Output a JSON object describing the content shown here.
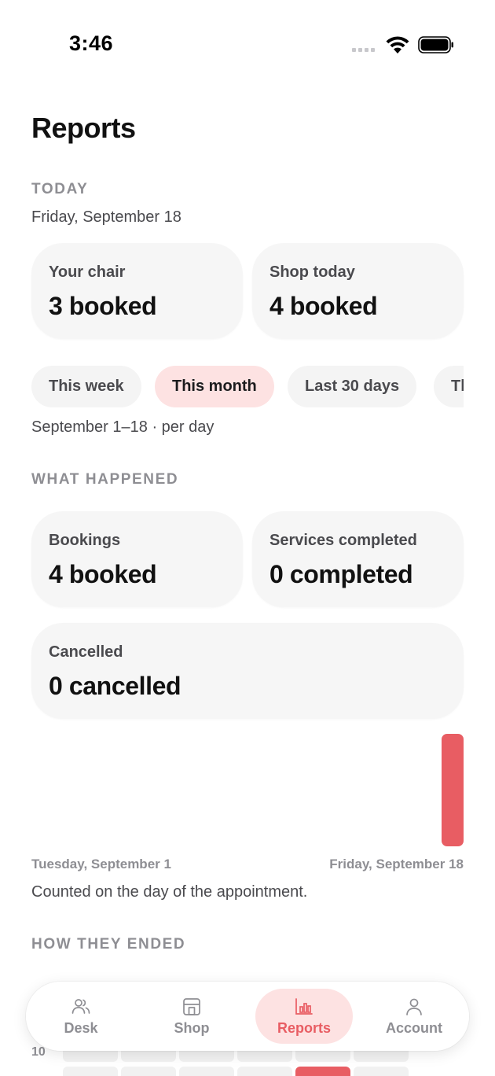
{
  "status": {
    "time": "3:46"
  },
  "title": "Reports",
  "today": {
    "label": "TODAY",
    "date": "Friday, September 18",
    "cards": [
      {
        "label": "Your chair",
        "value": "3 booked"
      },
      {
        "label": "Shop today",
        "value": "4 booked"
      }
    ]
  },
  "filters": {
    "chips": [
      "This week",
      "This month",
      "Last 30 days",
      "Th"
    ],
    "active": "This month",
    "range_text": "September 1–18 · per day"
  },
  "what_happened": {
    "label": "WHAT HAPPENED",
    "cards": [
      {
        "label": "Bookings",
        "value": "4 booked"
      },
      {
        "label": "Services completed",
        "value": "0 completed"
      },
      {
        "label": "Cancelled",
        "value": "0 cancelled"
      }
    ]
  },
  "chart": {
    "start_label": "Tuesday, September 1",
    "end_label": "Friday, September 18",
    "note": "Counted on the day of the appointment.",
    "accent": "#e85d63"
  },
  "how_they_ended": {
    "label": "HOW THEY ENDED",
    "row_number": "10"
  },
  "tabs": [
    {
      "label": "Desk",
      "icon": "people-icon"
    },
    {
      "label": "Shop",
      "icon": "storefront-icon"
    },
    {
      "label": "Reports",
      "icon": "bar-chart-icon"
    },
    {
      "label": "Account",
      "icon": "person-icon"
    }
  ],
  "active_tab": "Reports"
}
